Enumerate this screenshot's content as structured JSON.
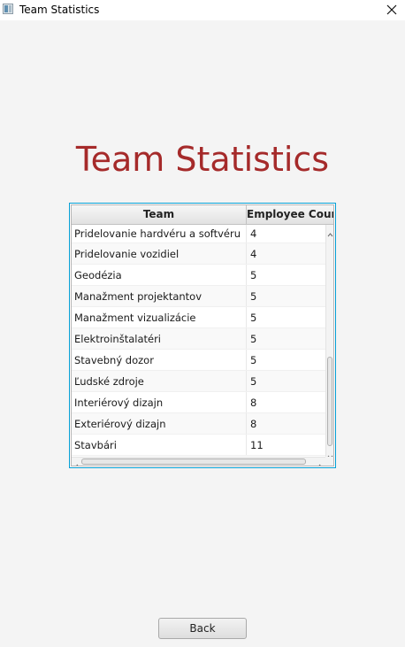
{
  "window": {
    "title": "Team Statistics",
    "icon": "app-window-icon",
    "close_icon": "close-icon"
  },
  "heading": "Team Statistics",
  "table": {
    "columns": [
      "Team",
      "Employee Count"
    ],
    "rows": [
      {
        "team": "Pridelovanie hardvéru a softvéru",
        "count": "4"
      },
      {
        "team": "Pridelovanie vozidiel",
        "count": "4"
      },
      {
        "team": "Geodézia",
        "count": "5"
      },
      {
        "team": "Manažment projektantov",
        "count": "5"
      },
      {
        "team": "Manažment vizualizácie",
        "count": "5"
      },
      {
        "team": "Elektroinštalatéri",
        "count": "5"
      },
      {
        "team": "Stavebný dozor",
        "count": "5"
      },
      {
        "team": "Ľudské zdroje",
        "count": "5"
      },
      {
        "team": "Interiérový dizajn",
        "count": "8"
      },
      {
        "team": "Exteriérový dizajn",
        "count": "8"
      },
      {
        "team": "Stavbári",
        "count": "11"
      }
    ]
  },
  "buttons": {
    "back": "Back"
  },
  "colors": {
    "heading": "#a52a2a",
    "table_focus_border": "#039ed3",
    "background": "#f4f4f4"
  }
}
